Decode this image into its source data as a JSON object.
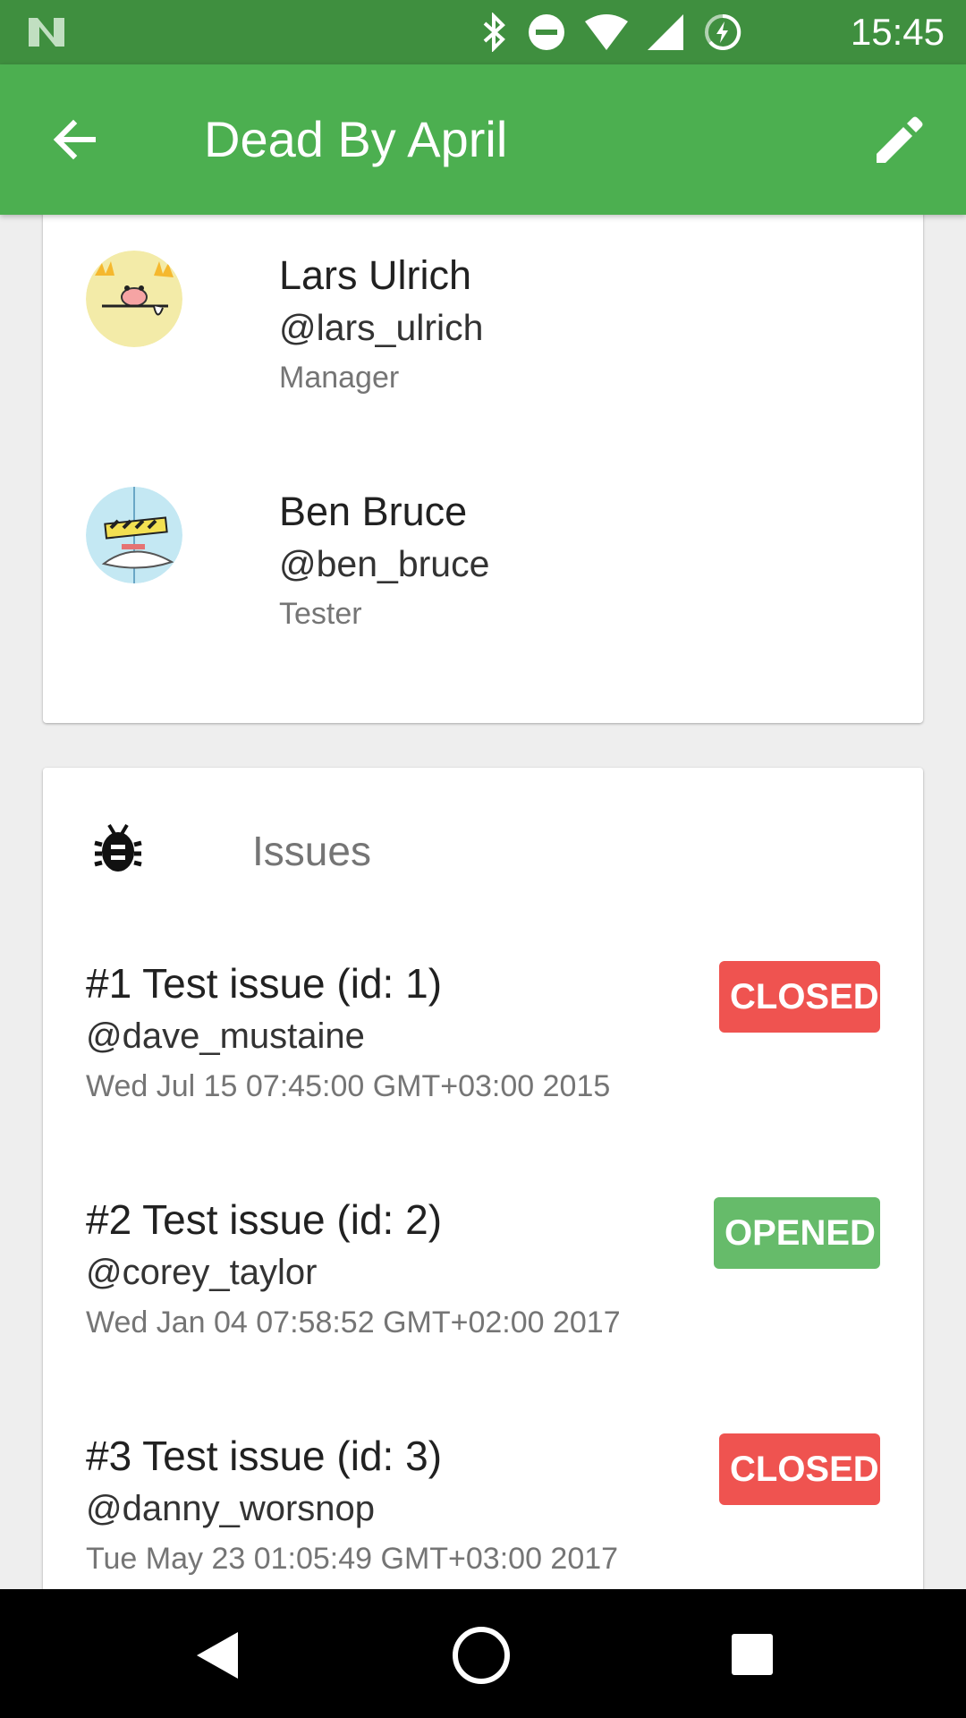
{
  "status_bar": {
    "time": "15:45",
    "icons": [
      "n-logo-icon",
      "bluetooth-icon",
      "do-not-disturb-icon",
      "wifi-icon",
      "cell-signal-icon",
      "battery-charging-icon"
    ]
  },
  "app_bar": {
    "title": "Dead By April",
    "back_icon": "arrow-back-icon",
    "edit_icon": "edit-pencil-icon"
  },
  "members": [
    {
      "name": "Lars Ulrich",
      "handle": "@lars_ulrich",
      "role": "Manager"
    },
    {
      "name": "Ben Bruce",
      "handle": "@ben_bruce",
      "role": "Tester"
    }
  ],
  "issues_section": {
    "title": "Issues",
    "icon": "bug-icon"
  },
  "issues": [
    {
      "title": "#1 Test issue (id: 1)",
      "author": "@dave_mustaine",
      "date": "Wed Jul 15 07:45:00 GMT+03:00 2015",
      "status": "CLOSED"
    },
    {
      "title": "#2 Test issue (id: 2)",
      "author": "@corey_taylor",
      "date": "Wed Jan 04 07:58:52 GMT+02:00 2017",
      "status": "OPENED"
    },
    {
      "title": "#3 Test issue (id: 3)",
      "author": "@danny_worsnop",
      "date": "Tue May 23 01:05:49 GMT+03:00 2017",
      "status": "CLOSED"
    }
  ],
  "colors": {
    "status_bar": "#3f8f3f",
    "app_bar": "#4caf50",
    "closed_badge": "#ef5350",
    "opened_badge": "#66bb6a"
  },
  "nav_bar": {
    "icons": [
      "nav-back-icon",
      "nav-home-icon",
      "nav-recent-icon"
    ]
  }
}
